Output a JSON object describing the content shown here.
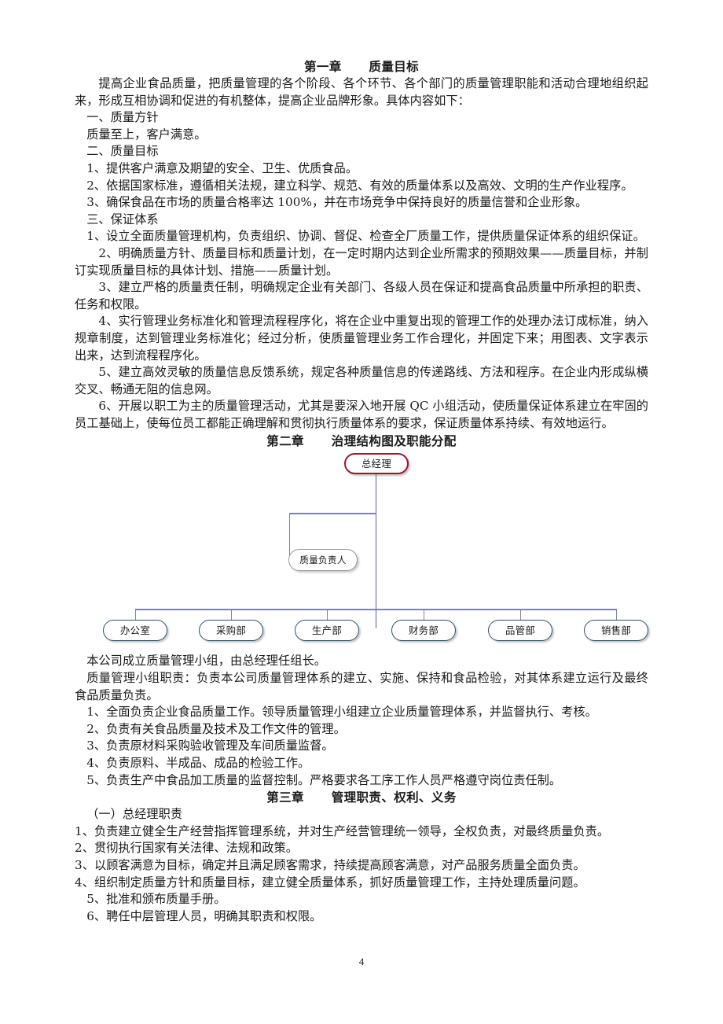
{
  "document": {
    "page_number": "4"
  },
  "chapter1": {
    "heading": "第一章      质量目标",
    "intro": "提高企业食品质量，把质量管理的各个阶段、各个环节、各个部门的质量管理职能和活动合理地组织起来，形成互相协调和促进的有机整体，提高企业品牌形象。具体内容如下：",
    "section1_title": "一、质量方针",
    "section1_body": "质量至上，客户满意。",
    "section2_title": "二、质量目标",
    "section2_items": [
      "1、提供客户满意及期望的安全、卫生、优质食品。",
      "2、依据国家标准，遵循相关法规，建立科学、规范、有效的质量体系以及高效、文明的生产作业程序。",
      "3、确保食品在市场的质量合格率达 100%，并在市场竞争中保持良好的质量信誉和企业形象。"
    ],
    "section3_title": "三、保证体系",
    "section3_items": [
      "1、设立全面质量管理机构，负责组织、协调、督促、检查全厂质量工作，提供质量保证体系的组织保证。",
      "2、明确质量方针、质量目标和质量计划，在一定时期内达到企业所需求的预期效果——质量目标，并制订实现质量目标的具体计划、措施——质量计划。",
      "3、建立严格的质量责任制，明确规定企业有关部门、各级人员在保证和提高食品质量中所承担的职责、任务和权限。",
      "4、实行管理业务标准化和管理流程程序化，将在企业中重复出现的管理工作的处理办法订成标准，纳入规章制度，达到管理业务标准化；经过分析，使质量管理业务工作合理化，并固定下来；用图表、文字表示出来，达到流程程序化。",
      "5、建立高效灵敏的质量信息反馈系统，规定各种质量信息的传递路线、方法和程序。在企业内形成纵横交叉、畅通无阻的信息网。",
      "6、开展以职工为主的质量管理活动，尤其是要深入地开展 QC 小组活动，使质量保证体系建立在牢固的员工基础上，使每位员工都能正确理解和贯彻执行质量体系的要求，保证质量体系持续、有效地运行。"
    ]
  },
  "chapter2": {
    "heading": "第二章      治理结构图及职能分配",
    "org_chart": {
      "top": {
        "label": "总经理",
        "color": "#a4122c"
      },
      "staff": {
        "label": "质量负责人",
        "color": "#9a9a9a"
      },
      "departments": [
        {
          "label": "办公室"
        },
        {
          "label": "采购部"
        },
        {
          "label": "生产部"
        },
        {
          "label": "财务部"
        },
        {
          "label": "品管部"
        },
        {
          "label": "销售部"
        }
      ],
      "department_color": "#2e5266",
      "connector_color": "#5b5f8c"
    },
    "note1": "本公司成立质量管理小组，由总经理任组长。",
    "note2": "质量管理小组职责：负责本公司质量管理体系的建立、实施、保持和食品检验，对其体系建立运行及最终食品质量负责。",
    "duties": [
      "1、全面负责企业食品质量工作。领导质量管理小组建立企业质量管理体系，并监督执行、考核。",
      "2、负责有关食品质量及技术及工作文件的管理。",
      "3、负责原材料采购验收管理及车间质量监督。",
      "4、负责原料、半成品、成品的检验工作。",
      "5、负责生产中食品加工质量的监督控制。严格要求各工序工作人员严格遵守岗位责任制。"
    ]
  },
  "chapter3": {
    "heading": "第三章      管理职责、权利、义务",
    "section1_title": "（一）总经理职责",
    "section1_items": [
      "1、负责建立健全生产经营指挥管理系统，并对生产经营管理统一领导，全权负责，对最终质量负责。",
      "2、贯彻执行国家有关法律、法规和政策。",
      "3、以顾客满意为目标，确定并且满足顾客需求，持续提高顾客满意，对产品服务质量全面负责。",
      "4、组织制定质量方针和质量目标，建立健全质量体系，抓好质量管理工作，主持处理质量问题。",
      "5、批准和颁布质量手册。",
      "6、聘任中层管理人员，明确其职责和权限。"
    ]
  }
}
